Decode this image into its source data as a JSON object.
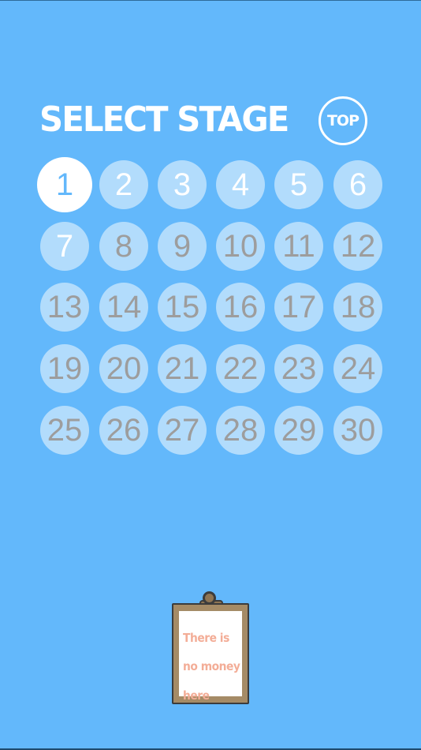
{
  "title": "SELECT STAGE",
  "top_button": "TOP",
  "stages": [
    {
      "label": "1",
      "state": "current"
    },
    {
      "label": "2",
      "state": "unlocked"
    },
    {
      "label": "3",
      "state": "unlocked"
    },
    {
      "label": "4",
      "state": "unlocked"
    },
    {
      "label": "5",
      "state": "unlocked"
    },
    {
      "label": "6",
      "state": "unlocked"
    },
    {
      "label": "7",
      "state": "unlocked"
    },
    {
      "label": "8",
      "state": "locked"
    },
    {
      "label": "9",
      "state": "locked"
    },
    {
      "label": "10",
      "state": "locked"
    },
    {
      "label": "11",
      "state": "locked"
    },
    {
      "label": "12",
      "state": "locked"
    },
    {
      "label": "13",
      "state": "locked"
    },
    {
      "label": "14",
      "state": "locked"
    },
    {
      "label": "15",
      "state": "locked"
    },
    {
      "label": "16",
      "state": "locked"
    },
    {
      "label": "17",
      "state": "locked"
    },
    {
      "label": "18",
      "state": "locked"
    },
    {
      "label": "19",
      "state": "locked"
    },
    {
      "label": "20",
      "state": "locked"
    },
    {
      "label": "21",
      "state": "locked"
    },
    {
      "label": "22",
      "state": "locked"
    },
    {
      "label": "23",
      "state": "locked"
    },
    {
      "label": "24",
      "state": "locked"
    },
    {
      "label": "25",
      "state": "locked"
    },
    {
      "label": "26",
      "state": "locked"
    },
    {
      "label": "27",
      "state": "locked"
    },
    {
      "label": "28",
      "state": "locked"
    },
    {
      "label": "29",
      "state": "locked"
    },
    {
      "label": "30",
      "state": "locked"
    }
  ],
  "clipboard": {
    "lines": [
      "There is",
      "no money",
      "here"
    ]
  },
  "colors": {
    "background": "#63b8fb",
    "stage_circle": "#b2dcfc",
    "stage_current": "#ffffff",
    "stage_locked_text": "#9d9d9d",
    "clipboard_text": "#f3ad97",
    "clipboard_board": "#a58b66"
  }
}
